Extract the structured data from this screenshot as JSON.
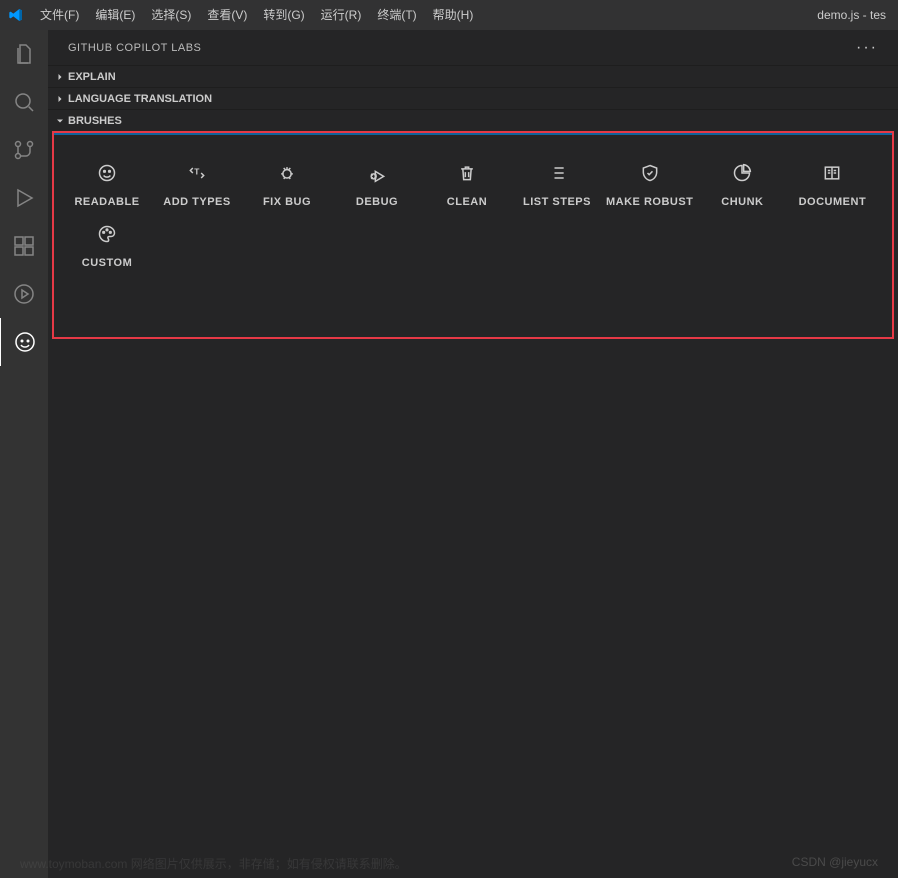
{
  "window_title": "demo.js - tes",
  "menu": [
    "文件(F)",
    "编辑(E)",
    "选择(S)",
    "查看(V)",
    "转到(G)",
    "运行(R)",
    "终端(T)",
    "帮助(H)"
  ],
  "sidebar": {
    "title": "GITHUB COPILOT LABS",
    "sections": [
      {
        "label": "EXPLAIN",
        "expanded": false
      },
      {
        "label": "LANGUAGE TRANSLATION",
        "expanded": false
      },
      {
        "label": "BRUSHES",
        "expanded": true
      }
    ]
  },
  "brushes": [
    {
      "label": "READABLE",
      "icon": "smile-icon"
    },
    {
      "label": "ADD TYPES",
      "icon": "types-icon"
    },
    {
      "label": "FIX BUG",
      "icon": "bug-icon"
    },
    {
      "label": "DEBUG",
      "icon": "debug-icon"
    },
    {
      "label": "CLEAN",
      "icon": "trash-icon"
    },
    {
      "label": "LIST STEPS",
      "icon": "list-icon"
    },
    {
      "label": "MAKE ROBUST",
      "icon": "shield-icon"
    },
    {
      "label": "CHUNK",
      "icon": "pie-icon"
    },
    {
      "label": "DOCUMENT",
      "icon": "book-icon"
    },
    {
      "label": "CUSTOM",
      "icon": "palette-icon"
    }
  ],
  "watermarks": {
    "left": "www.toymoban.com 网络图片仅供展示，非存储；如有侵权请联系删除。",
    "right": "CSDN @jieyucx"
  }
}
